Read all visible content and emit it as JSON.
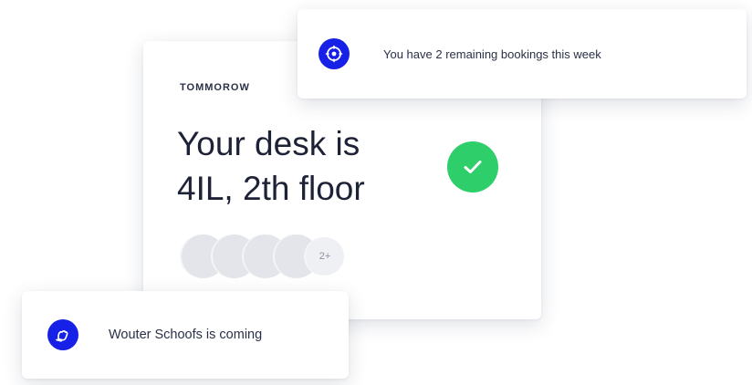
{
  "booking_card": {
    "eyebrow": "TOMMOROW",
    "headline_line1": "Your desk is",
    "headline_line2": "4IL, 2th floor",
    "attendees_more": "2+",
    "status_icon": "checkmark-icon",
    "status_color": "#2ecf6b"
  },
  "notifications": {
    "bookings": {
      "icon": "compass-icon",
      "text": "You have 2 remaining bookings this week"
    },
    "colleague": {
      "icon": "hand-wave-icon",
      "text": "Wouter Schoofs is coming"
    }
  },
  "colors": {
    "accent": "#1620e6",
    "text": "#1d2236"
  }
}
